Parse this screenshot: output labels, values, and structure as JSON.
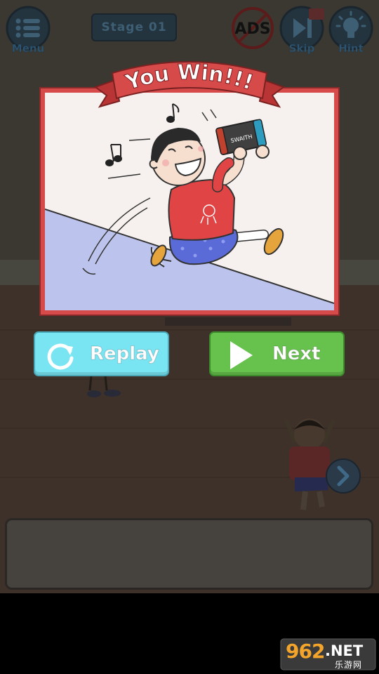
{
  "topbar": {
    "menu_label": "Menu",
    "stage_label": "Stage 01",
    "ads_label": "ADS",
    "skip_label": "Skip",
    "hint_label": "Hint"
  },
  "win_dialog": {
    "title": "You Win!!!",
    "console_label": "SWAITH",
    "replay_label": "Replay",
    "next_label": "Next"
  },
  "watermark": {
    "code": "962",
    "domain": ".NET",
    "chinese": "乐游网"
  },
  "colors": {
    "dim_background": "#3a3830",
    "ribbon_red": "#d64a4a",
    "replay_cyan": "#79e5f3",
    "next_green": "#66c24d",
    "shirt_red": "#e04444",
    "shorts_blue": "#5a6bd8"
  },
  "icons": [
    "menu-icon",
    "no-ads-icon",
    "skip-icon",
    "hint-bulb-icon",
    "replay-icon",
    "play-icon",
    "arrow-right-icon"
  ]
}
